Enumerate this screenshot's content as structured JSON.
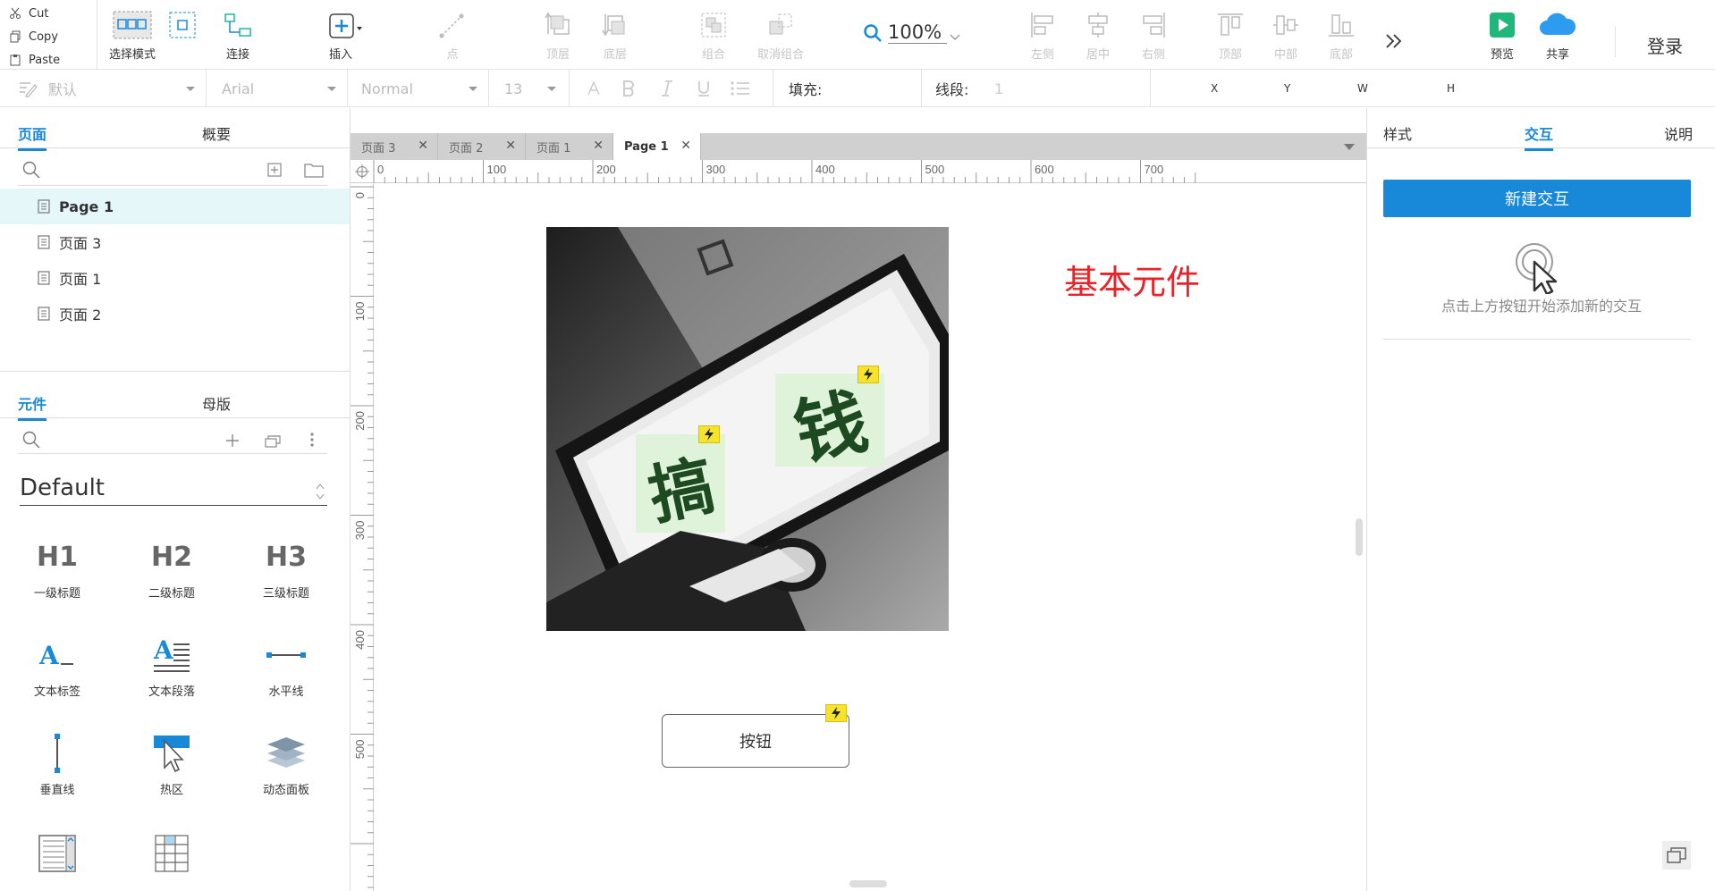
{
  "clipboard": {
    "cut": "Cut",
    "copy": "Copy",
    "paste": "Paste"
  },
  "toolbar": {
    "select_mode": "选择模式",
    "connect": "连接",
    "insert": "插入",
    "point": "点",
    "top_layer": "顶层",
    "bottom_layer": "底层",
    "group": "组合",
    "ungroup": "取消组合",
    "zoom": "100%",
    "align_left": "左侧",
    "align_center": "居中",
    "align_right": "右侧",
    "align_top": "顶部",
    "align_middle": "中部",
    "align_bottom": "底部",
    "preview": "预览",
    "share": "共享",
    "login": "登录"
  },
  "format": {
    "style": "默认",
    "font": "Arial",
    "weight": "Normal",
    "size": "13",
    "fill_label": "填充:",
    "stroke_label": "线段:",
    "stroke_value": "1",
    "x": "X",
    "y": "Y",
    "w": "W",
    "h": "H"
  },
  "left": {
    "tab_pages": "页面",
    "tab_outline": "概要",
    "pages": [
      {
        "label": "Page 1"
      },
      {
        "label": "页面 3"
      },
      {
        "label": "页面 1"
      },
      {
        "label": "页面 2"
      }
    ],
    "tab_widgets": "元件",
    "tab_masters": "母版",
    "library": "Default",
    "widgets": [
      {
        "label": "一级标题",
        "glyph": "H1"
      },
      {
        "label": "二级标题",
        "glyph": "H2"
      },
      {
        "label": "三级标题",
        "glyph": "H3"
      },
      {
        "label": "文本标签"
      },
      {
        "label": "文本段落"
      },
      {
        "label": "水平线"
      },
      {
        "label": "垂直线"
      },
      {
        "label": "热区"
      },
      {
        "label": "动态面板"
      }
    ]
  },
  "tabs": [
    {
      "label": "页面 3"
    },
    {
      "label": "页面 2"
    },
    {
      "label": "页面 1"
    },
    {
      "label": "Page 1"
    }
  ],
  "ruler": {
    "h": [
      "0",
      "100",
      "200",
      "300",
      "400",
      "500",
      "600",
      "700"
    ],
    "v": [
      "0",
      "100",
      "200",
      "300",
      "400",
      "500"
    ]
  },
  "canvas": {
    "title": "基本元件",
    "image_chars": [
      "搞",
      "钱"
    ],
    "button_label": "按钮",
    "title_color": "#e8242a"
  },
  "right": {
    "tab_style": "样式",
    "tab_interact": "交互",
    "tab_notes": "说明",
    "new_interaction": "新建交互",
    "hint": "点击上方按钮开始添加新的交互"
  },
  "colors": {
    "accent": "#1888d8",
    "preview": "#1fb77a",
    "share": "#2c9cf0"
  }
}
